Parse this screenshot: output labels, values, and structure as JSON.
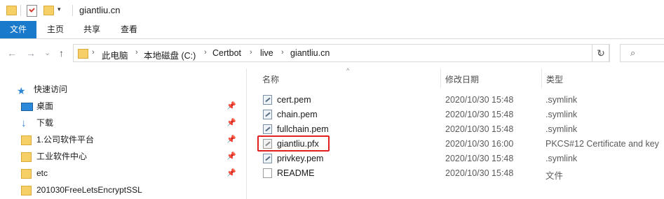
{
  "window": {
    "title": "giantliu.cn",
    "quick_access_dropdown": "▾"
  },
  "ribbon": {
    "tabs": [
      "文件",
      "主页",
      "共享",
      "查看"
    ]
  },
  "address": {
    "breadcrumbs": [
      "此电脑",
      "本地磁盘 (C:)",
      "Certbot",
      "live",
      "giantliu.cn"
    ],
    "separator": "›"
  },
  "nav": {
    "back": "←",
    "forward": "→",
    "recent": "⌄",
    "up": "↑",
    "refresh": "↻",
    "search_icon": "⌕",
    "dropdown": "⌄"
  },
  "sidebar": {
    "items": [
      {
        "label": "快速访问",
        "icon": "star-icon",
        "pinned": false
      },
      {
        "label": "桌面",
        "icon": "desktop-icon",
        "pinned": true
      },
      {
        "label": "下载",
        "icon": "download-icon",
        "pinned": true
      },
      {
        "label": "1.公司软件平台",
        "icon": "folder-icon",
        "pinned": true
      },
      {
        "label": "工业软件中心",
        "icon": "folder-icon",
        "pinned": true
      },
      {
        "label": "etc",
        "icon": "folder-icon",
        "pinned": true
      },
      {
        "label": "201030FreeLetsEncryptSSL",
        "icon": "folder-icon",
        "pinned": false
      }
    ],
    "pin_glyph": "📌"
  },
  "columns": {
    "name": "名称",
    "date": "修改日期",
    "type": "类型",
    "sort_indicator": "^"
  },
  "files": [
    {
      "name": "cert.pem",
      "date": "2020/10/30 15:48",
      "type": ".symlink",
      "icon": "symlink-icon"
    },
    {
      "name": "chain.pem",
      "date": "2020/10/30 15:48",
      "type": ".symlink",
      "icon": "symlink-icon"
    },
    {
      "name": "fullchain.pem",
      "date": "2020/10/30 15:48",
      "type": ".symlink",
      "icon": "symlink-icon"
    },
    {
      "name": "giantliu.pfx",
      "date": "2020/10/30 16:00",
      "type": "PKCS#12 Certificate and key",
      "icon": "pfx-certificate-icon"
    },
    {
      "name": "privkey.pem",
      "date": "2020/10/30 15:48",
      "type": ".symlink",
      "icon": "symlink-icon"
    },
    {
      "name": "README",
      "date": "2020/10/30 15:48",
      "type": "文件",
      "icon": "file-icon"
    }
  ],
  "colors": {
    "ribbon_file_tab": "#1979ca",
    "highlight_box": "#e02020",
    "folder": "#f6cf67"
  }
}
